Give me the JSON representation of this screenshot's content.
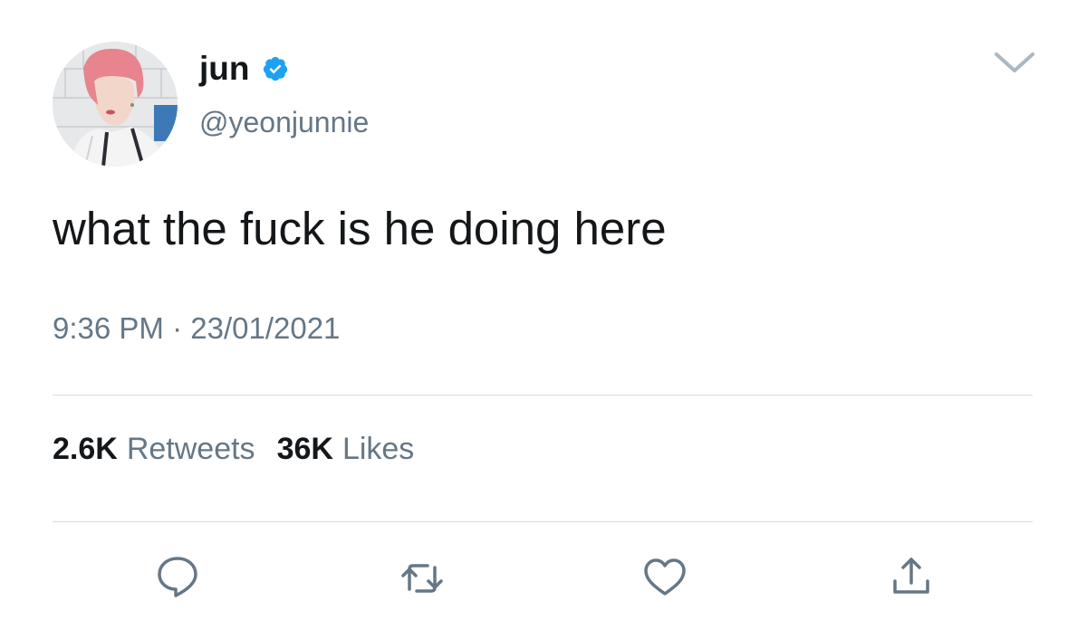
{
  "tweet": {
    "display_name": "jun",
    "handle": "@yeonjunnie",
    "text": "what the fuck is he doing here",
    "time": "9:36 PM",
    "separator": "·",
    "date": "23/01/2021",
    "verified": true,
    "avatar": "profile-photo"
  },
  "stats": {
    "retweets_count": "2.6K",
    "retweets_label": "Retweets",
    "likes_count": "36K",
    "likes_label": "Likes"
  },
  "actions": [
    {
      "icon": "reply-icon"
    },
    {
      "icon": "retweet-icon"
    },
    {
      "icon": "like-icon"
    },
    {
      "icon": "share-icon"
    }
  ],
  "menu": {
    "icon": "chevron-down-icon"
  },
  "colors": {
    "text": "#14171a",
    "secondary": "#657786",
    "verified": "#1da1f2",
    "divider": "#d5dbe0",
    "icon": "#657786"
  }
}
